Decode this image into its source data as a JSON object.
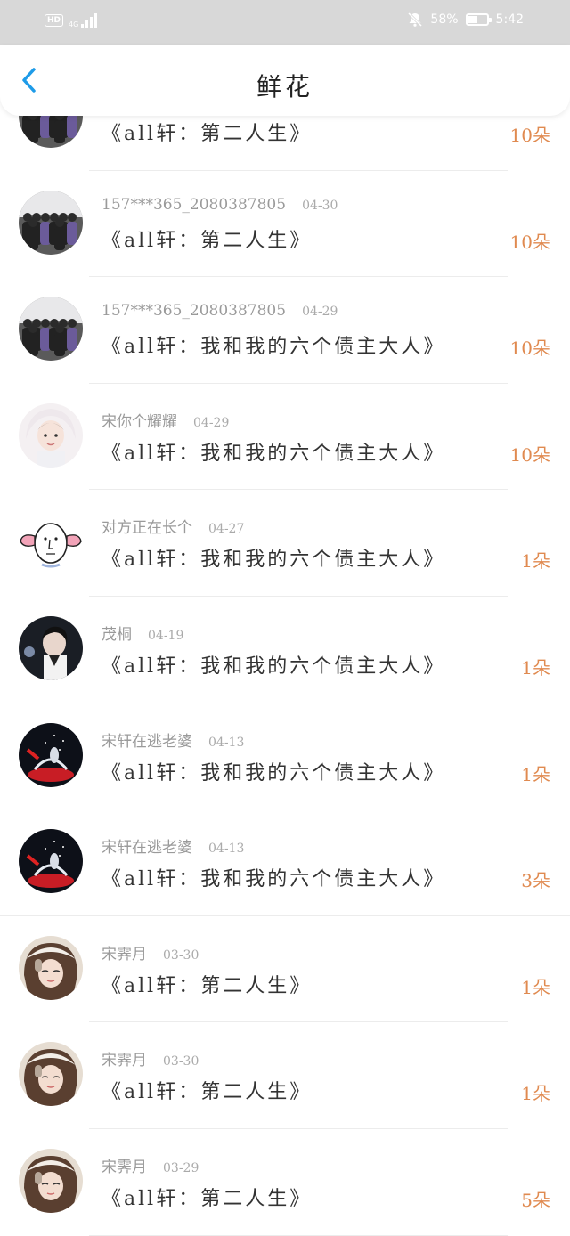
{
  "status_bar": {
    "hd": "HD",
    "network": "4G",
    "battery_percent": "58%",
    "battery_level": 0.58,
    "time": "5:42",
    "icons": [
      "hd-icon",
      "signal-icon",
      "bell-off-icon",
      "battery-icon"
    ]
  },
  "header": {
    "title": "鲜花",
    "back_icon": "chevron-left-icon"
  },
  "colors": {
    "accent": "#1e9be8",
    "count": "#e08a50",
    "status_bar_bg": "#d8d8d8"
  },
  "items": [
    {
      "user": "",
      "date": "",
      "title": "《all轩：第二人生》",
      "count": "10朵",
      "avatar": "group-photo"
    },
    {
      "user": "157***365_2080387805",
      "date": "04-30",
      "title": "《all轩：第二人生》",
      "count": "10朵",
      "avatar": "group-photo"
    },
    {
      "user": "157***365_2080387805",
      "date": "04-29",
      "title": "《all轩：我和我的六个债主大人》",
      "count": "10朵",
      "avatar": "group-photo"
    },
    {
      "user": "宋你个耀耀",
      "date": "04-29",
      "title": "《all轩：我和我的六个债主大人》",
      "count": "10朵",
      "avatar": "child-photo"
    },
    {
      "user": "对方正在长个",
      "date": "04-27",
      "title": "《all轩：我和我的六个债主大人》",
      "count": "1朵",
      "avatar": "cartoon-face"
    },
    {
      "user": "茂桐",
      "date": "04-19",
      "title": "《all轩：我和我的六个债主大人》",
      "count": "1朵",
      "avatar": "portrait-dark"
    },
    {
      "user": "宋轩在逃老婆",
      "date": "04-13",
      "title": "《all轩：我和我的六个债主大人》",
      "count": "1朵",
      "avatar": "stage-photo"
    },
    {
      "user": "宋轩在逃老婆",
      "date": "04-13",
      "title": "《all轩：我和我的六个债主大人》",
      "count": "3朵",
      "avatar": "stage-photo"
    },
    {
      "user": "宋霁月",
      "date": "03-30",
      "title": "《all轩：第二人生》",
      "count": "1朵",
      "avatar": "girl-photo"
    },
    {
      "user": "宋霁月",
      "date": "03-30",
      "title": "《all轩：第二人生》",
      "count": "1朵",
      "avatar": "girl-photo"
    },
    {
      "user": "宋霁月",
      "date": "03-29",
      "title": "《all轩：第二人生》",
      "count": "5朵",
      "avatar": "girl-photo"
    }
  ]
}
